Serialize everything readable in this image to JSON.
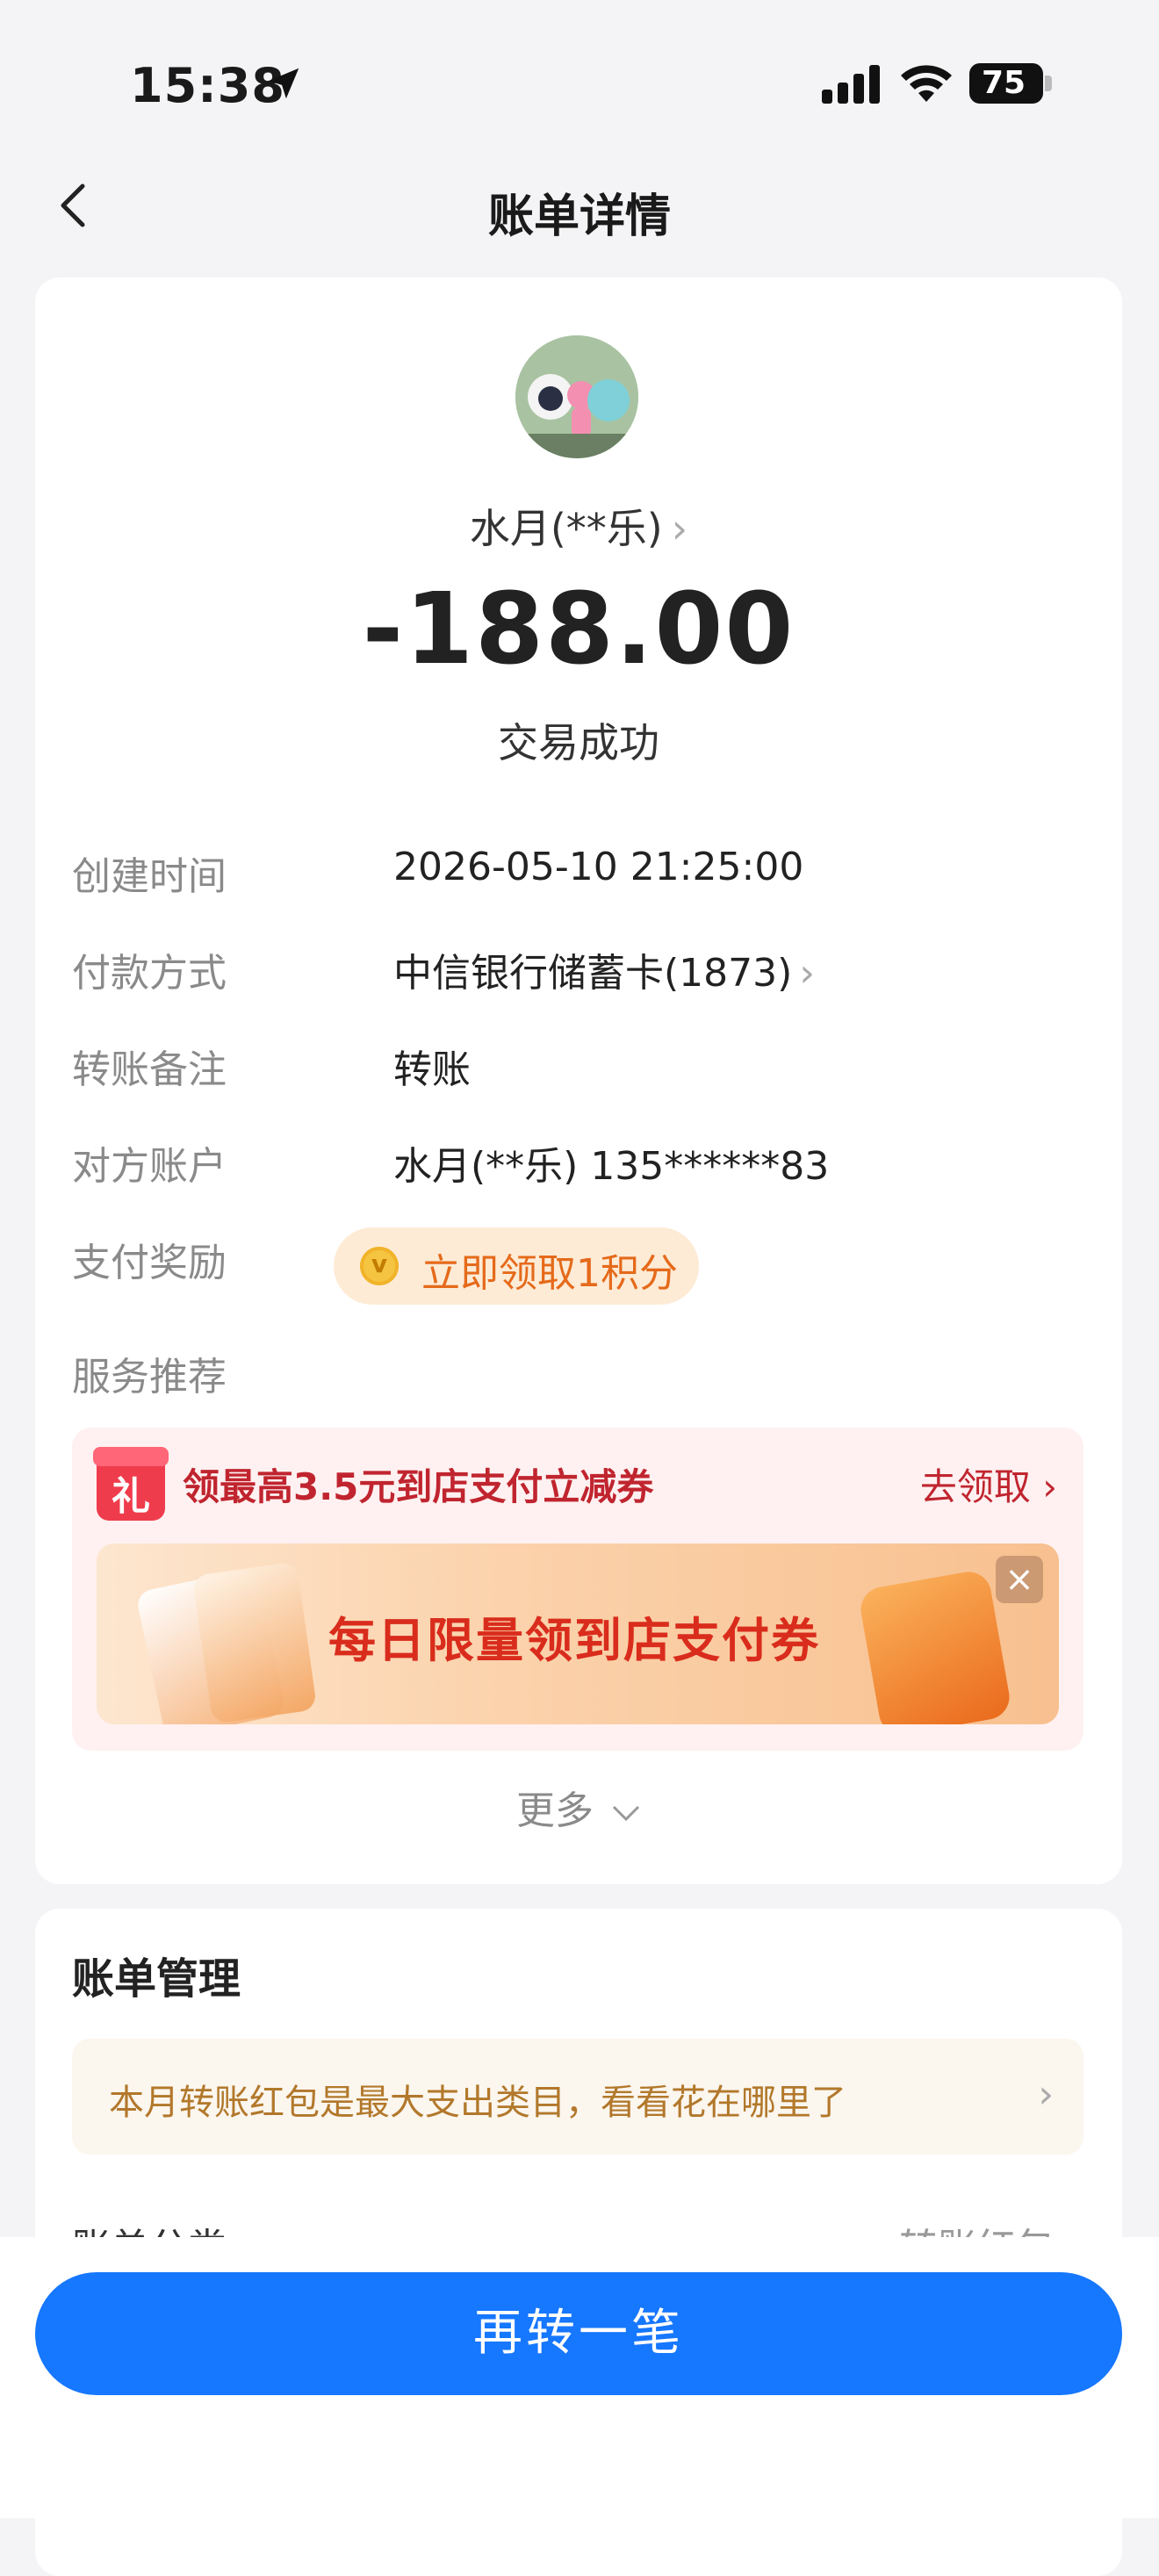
{
  "status_bar": {
    "time": "15:38",
    "battery": "75"
  },
  "nav": {
    "title": "账单详情"
  },
  "transaction": {
    "payee": "水月(**乐)",
    "amount": "-188.00",
    "status": "交易成功"
  },
  "details": [
    {
      "label": "创建时间",
      "value": "2026-05-10 21:25:00"
    },
    {
      "label": "付款方式",
      "value": "中信银行储蓄卡(1873)"
    },
    {
      "label": "转账备注",
      "value": "转账"
    },
    {
      "label": "对方账户",
      "value": "水月(**乐) 135******83"
    },
    {
      "label": "支付奖励",
      "value": "立即领取1积分"
    },
    {
      "label": "服务推荐",
      "value": ""
    }
  ],
  "promo": {
    "gift_glyph": "礼",
    "title": "领最高3.5元到店支付立减券",
    "link": "去领取",
    "banner_text": "每日限量领到店支付券"
  },
  "more_label": "更多",
  "bill_management": {
    "title": "账单管理",
    "insight": "本月转账红包是最大支出类目，看看花在哪里了",
    "category_label": "账单分类",
    "category_value": "转账红包"
  },
  "cta": {
    "label": "再转一笔"
  },
  "colors": {
    "primary": "#1677ff",
    "reward_text": "#e56a1a",
    "promo_red": "#c0252f",
    "insight_text": "#b2782b"
  }
}
